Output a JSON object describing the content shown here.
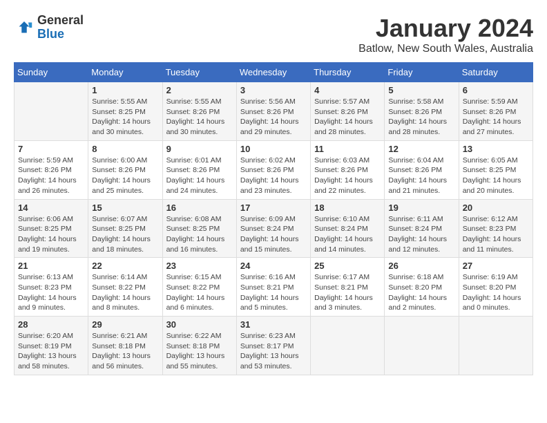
{
  "logo": {
    "general": "General",
    "blue": "Blue"
  },
  "title": "January 2024",
  "location": "Batlow, New South Wales, Australia",
  "days_of_week": [
    "Sunday",
    "Monday",
    "Tuesday",
    "Wednesday",
    "Thursday",
    "Friday",
    "Saturday"
  ],
  "weeks": [
    [
      {
        "day": "",
        "info": ""
      },
      {
        "day": "1",
        "info": "Sunrise: 5:55 AM\nSunset: 8:25 PM\nDaylight: 14 hours\nand 30 minutes."
      },
      {
        "day": "2",
        "info": "Sunrise: 5:55 AM\nSunset: 8:26 PM\nDaylight: 14 hours\nand 30 minutes."
      },
      {
        "day": "3",
        "info": "Sunrise: 5:56 AM\nSunset: 8:26 PM\nDaylight: 14 hours\nand 29 minutes."
      },
      {
        "day": "4",
        "info": "Sunrise: 5:57 AM\nSunset: 8:26 PM\nDaylight: 14 hours\nand 28 minutes."
      },
      {
        "day": "5",
        "info": "Sunrise: 5:58 AM\nSunset: 8:26 PM\nDaylight: 14 hours\nand 28 minutes."
      },
      {
        "day": "6",
        "info": "Sunrise: 5:59 AM\nSunset: 8:26 PM\nDaylight: 14 hours\nand 27 minutes."
      }
    ],
    [
      {
        "day": "7",
        "info": "Sunrise: 5:59 AM\nSunset: 8:26 PM\nDaylight: 14 hours\nand 26 minutes."
      },
      {
        "day": "8",
        "info": "Sunrise: 6:00 AM\nSunset: 8:26 PM\nDaylight: 14 hours\nand 25 minutes."
      },
      {
        "day": "9",
        "info": "Sunrise: 6:01 AM\nSunset: 8:26 PM\nDaylight: 14 hours\nand 24 minutes."
      },
      {
        "day": "10",
        "info": "Sunrise: 6:02 AM\nSunset: 8:26 PM\nDaylight: 14 hours\nand 23 minutes."
      },
      {
        "day": "11",
        "info": "Sunrise: 6:03 AM\nSunset: 8:26 PM\nDaylight: 14 hours\nand 22 minutes."
      },
      {
        "day": "12",
        "info": "Sunrise: 6:04 AM\nSunset: 8:26 PM\nDaylight: 14 hours\nand 21 minutes."
      },
      {
        "day": "13",
        "info": "Sunrise: 6:05 AM\nSunset: 8:25 PM\nDaylight: 14 hours\nand 20 minutes."
      }
    ],
    [
      {
        "day": "14",
        "info": "Sunrise: 6:06 AM\nSunset: 8:25 PM\nDaylight: 14 hours\nand 19 minutes."
      },
      {
        "day": "15",
        "info": "Sunrise: 6:07 AM\nSunset: 8:25 PM\nDaylight: 14 hours\nand 18 minutes."
      },
      {
        "day": "16",
        "info": "Sunrise: 6:08 AM\nSunset: 8:25 PM\nDaylight: 14 hours\nand 16 minutes."
      },
      {
        "day": "17",
        "info": "Sunrise: 6:09 AM\nSunset: 8:24 PM\nDaylight: 14 hours\nand 15 minutes."
      },
      {
        "day": "18",
        "info": "Sunrise: 6:10 AM\nSunset: 8:24 PM\nDaylight: 14 hours\nand 14 minutes."
      },
      {
        "day": "19",
        "info": "Sunrise: 6:11 AM\nSunset: 8:24 PM\nDaylight: 14 hours\nand 12 minutes."
      },
      {
        "day": "20",
        "info": "Sunrise: 6:12 AM\nSunset: 8:23 PM\nDaylight: 14 hours\nand 11 minutes."
      }
    ],
    [
      {
        "day": "21",
        "info": "Sunrise: 6:13 AM\nSunset: 8:23 PM\nDaylight: 14 hours\nand 9 minutes."
      },
      {
        "day": "22",
        "info": "Sunrise: 6:14 AM\nSunset: 8:22 PM\nDaylight: 14 hours\nand 8 minutes."
      },
      {
        "day": "23",
        "info": "Sunrise: 6:15 AM\nSunset: 8:22 PM\nDaylight: 14 hours\nand 6 minutes."
      },
      {
        "day": "24",
        "info": "Sunrise: 6:16 AM\nSunset: 8:21 PM\nDaylight: 14 hours\nand 5 minutes."
      },
      {
        "day": "25",
        "info": "Sunrise: 6:17 AM\nSunset: 8:21 PM\nDaylight: 14 hours\nand 3 minutes."
      },
      {
        "day": "26",
        "info": "Sunrise: 6:18 AM\nSunset: 8:20 PM\nDaylight: 14 hours\nand 2 minutes."
      },
      {
        "day": "27",
        "info": "Sunrise: 6:19 AM\nSunset: 8:20 PM\nDaylight: 14 hours\nand 0 minutes."
      }
    ],
    [
      {
        "day": "28",
        "info": "Sunrise: 6:20 AM\nSunset: 8:19 PM\nDaylight: 13 hours\nand 58 minutes."
      },
      {
        "day": "29",
        "info": "Sunrise: 6:21 AM\nSunset: 8:18 PM\nDaylight: 13 hours\nand 56 minutes."
      },
      {
        "day": "30",
        "info": "Sunrise: 6:22 AM\nSunset: 8:18 PM\nDaylight: 13 hours\nand 55 minutes."
      },
      {
        "day": "31",
        "info": "Sunrise: 6:23 AM\nSunset: 8:17 PM\nDaylight: 13 hours\nand 53 minutes."
      },
      {
        "day": "",
        "info": ""
      },
      {
        "day": "",
        "info": ""
      },
      {
        "day": "",
        "info": ""
      }
    ]
  ]
}
